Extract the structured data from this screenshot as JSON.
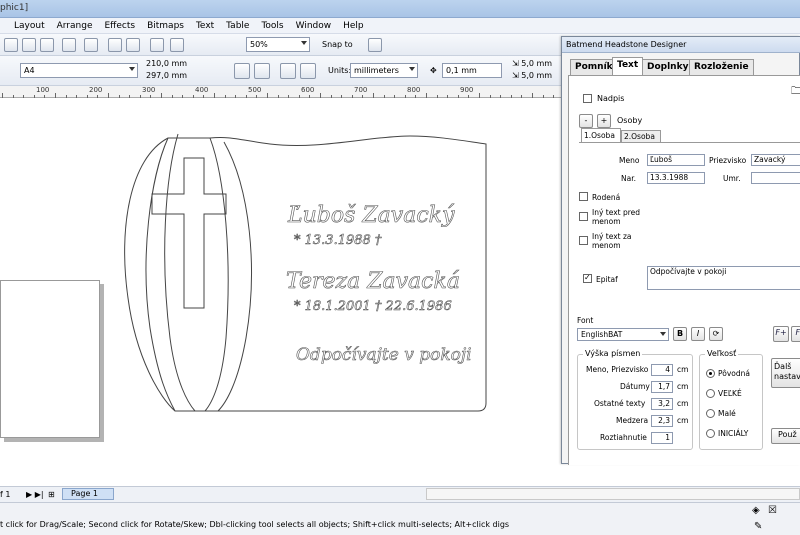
{
  "window": {
    "title_fragment": "phic1]"
  },
  "menu": {
    "items": [
      "Layout",
      "Arrange",
      "Effects",
      "Bitmaps",
      "Text",
      "Table",
      "Tools",
      "Window",
      "Help"
    ]
  },
  "toolbar": {
    "zoom": "50%",
    "snap_to": "Snap to"
  },
  "property_bar": {
    "paper_size": "A4",
    "width": "210,0 mm",
    "height": "297,0 mm",
    "units_label": "Units:",
    "units_value": "millimeters",
    "nudge": "0,1 mm",
    "dup_x": "5,0 mm",
    "dup_y": "5,0 mm"
  },
  "ruler": {
    "labels": [
      "100",
      "200",
      "300",
      "400",
      "500",
      "600",
      "700",
      "800",
      "900"
    ]
  },
  "headstone": {
    "name1": "Ľuboš Zavacký",
    "dates1": "* 13.3.1988  †",
    "name2": "Tereza Zavacká",
    "dates2": "* 18.1.2001  † 22.6.1986",
    "epitaph": "Odpočívajte v pokoji"
  },
  "page_nav": {
    "counter": "f 1",
    "page_tab": "Page 1"
  },
  "status": {
    "text": "t click for Drag/Scale; Second click for Rotate/Skew; Dbl-clicking tool selects all objects; Shift+click multi-selects; Alt+click digs"
  },
  "dialog": {
    "title": "Batmend Headstone Designer",
    "tabs": [
      "Pomník",
      "Text",
      "Doplnky",
      "Rozloženie"
    ],
    "nadpis_label": "Nadpis",
    "osoby_label": "Osoby",
    "minus": "-",
    "plus": "+",
    "person_tabs": [
      "1.Osoba",
      "2.Osoba"
    ],
    "meno_label": "Meno",
    "meno_value": "Ľuboš",
    "priezvisko_label": "Priezvisko",
    "priezvisko_value": "Zavacký",
    "nar_label": "Nar.",
    "nar_value": "13.3.1988",
    "umr_label": "Umr.",
    "umr_value": "",
    "rodena_label": "Rodená",
    "iny_pred_label": "Iný text pred menom",
    "iny_za_label": "Iný text za menom",
    "epitaf_label": "Epitaf",
    "epitaf_value": "Odpočívajte v pokoji",
    "font_label": "Font",
    "font_value": "EnglishBAT",
    "bold": "B",
    "italic": "I",
    "vyska_title": "Výška písmen",
    "vyska_rows": [
      {
        "label": "Meno, Priezvisko",
        "value": "4",
        "unit": "cm"
      },
      {
        "label": "Dátumy",
        "value": "1,7",
        "unit": "cm"
      },
      {
        "label": "Ostatné texty",
        "value": "3,2",
        "unit": "cm"
      },
      {
        "label": "Medzera",
        "value": "2,3",
        "unit": "cm"
      },
      {
        "label": "Roztiahnutie",
        "value": "1",
        "unit": ""
      }
    ],
    "velkost_title": "Veľkosť",
    "velkost_options": [
      "Pôvodná",
      "VEĽKÉ",
      "Malé",
      "INICIÁLY"
    ],
    "side_btn1": "Ďalš nastav",
    "side_btn2": "Použ",
    "fplus": "F+",
    "fminus": "F-"
  }
}
